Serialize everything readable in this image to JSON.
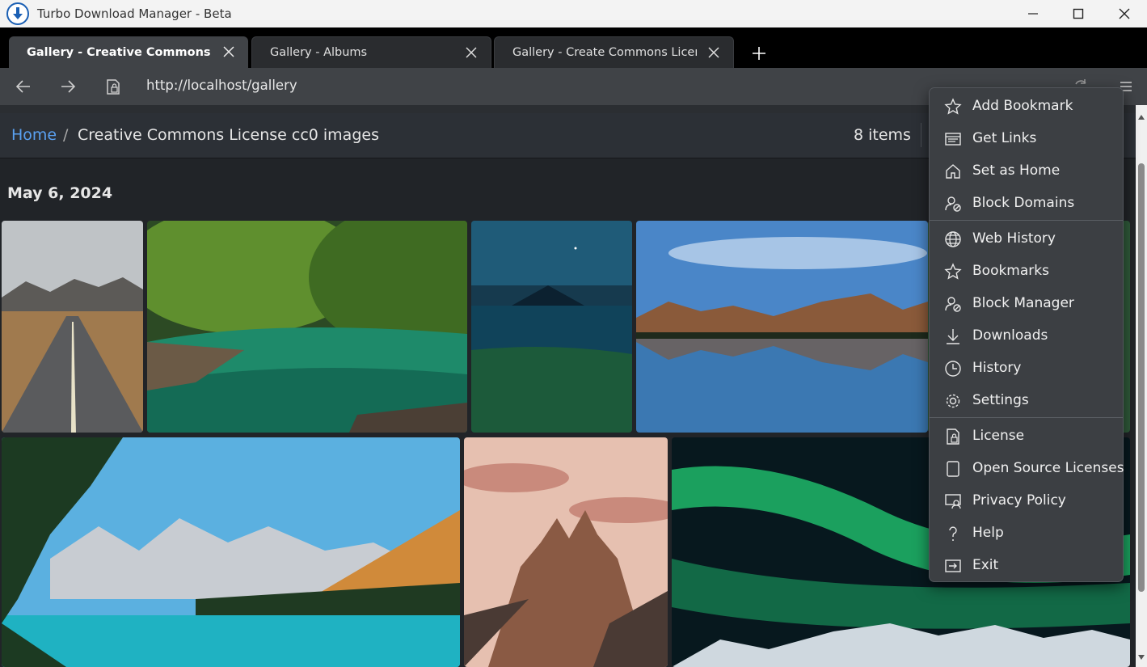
{
  "window": {
    "title": "Turbo Download Manager - Beta"
  },
  "tabs": [
    {
      "label": "Gallery - Creative Commons Licer",
      "active": true
    },
    {
      "label": "Gallery - Albums",
      "active": false
    },
    {
      "label": "Gallery - Create Commons License",
      "active": false
    }
  ],
  "address": {
    "url": "http://localhost/gallery"
  },
  "breadcrumb": {
    "home": "Home",
    "separator": "/",
    "current": "Creative Commons License cc0 images"
  },
  "item_count": "8 items",
  "gallery": {
    "date": "May 6, 2024",
    "photos": [
      "road-mountains",
      "forest-river",
      "night-volcano-lake",
      "mountain-lake-reflection",
      "turquoise-mountain-lake",
      "rocky-peak-sunset",
      "aurora-borealis"
    ]
  },
  "menu": {
    "items": [
      {
        "label": "Add Bookmark",
        "icon": "star-icon"
      },
      {
        "label": "Get Links",
        "icon": "links-icon"
      },
      {
        "label": "Set as Home",
        "icon": "home-icon"
      },
      {
        "label": "Block Domains",
        "icon": "block-user-icon"
      },
      {
        "label": "Web History",
        "icon": "globe-icon"
      },
      {
        "label": "Bookmarks",
        "icon": "star-icon"
      },
      {
        "label": "Block Manager",
        "icon": "block-user-icon"
      },
      {
        "label": "Downloads",
        "icon": "download-icon"
      },
      {
        "label": "History",
        "icon": "clock-icon"
      },
      {
        "label": "Settings",
        "icon": "gear-icon"
      },
      {
        "label": "License",
        "icon": "lock-document-icon"
      },
      {
        "label": "Open Source Licenses",
        "icon": "document-icon"
      },
      {
        "label": "Privacy Policy",
        "icon": "privacy-icon"
      },
      {
        "label": "Help",
        "icon": "question-icon"
      },
      {
        "label": "Exit",
        "icon": "exit-icon"
      }
    ]
  },
  "colors": {
    "accent_link": "#5aa0f0",
    "menu_bg": "#3c3f43",
    "tab_active_bg": "#404347"
  }
}
